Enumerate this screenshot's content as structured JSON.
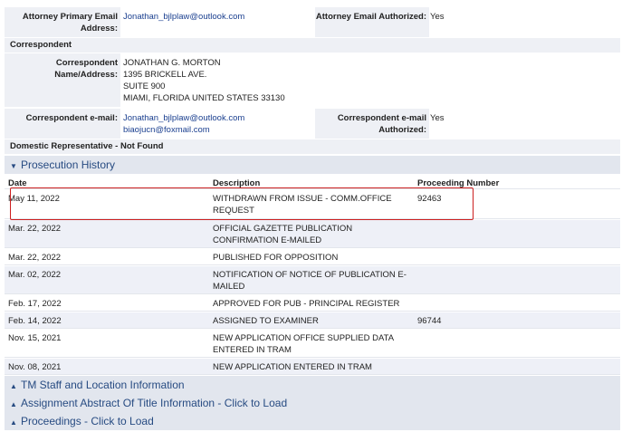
{
  "attorney": {
    "email_label": "Attorney Primary Email Address:",
    "email_value": "Jonathan_bjlplaw@outlook.com",
    "email_auth_label": "Attorney Email Authorized:",
    "email_auth_value": "Yes"
  },
  "correspondent": {
    "section_label": "Correspondent",
    "name_label": "Correspondent Name/Address:",
    "address_lines": [
      "JONATHAN G. MORTON",
      "1395 BRICKELL AVE.",
      "SUITE 900",
      "MIAMI, FLORIDA UNITED STATES 33130"
    ],
    "email_label": "Correspondent e-mail:",
    "emails": [
      "Jonathan_bjlplaw@outlook.com",
      "biaojucn@foxmail.com"
    ],
    "email_auth_label": "Correspondent e-mail Authorized:",
    "email_auth_value": "Yes"
  },
  "domestic_rep": "Domestic Representative - Not Found",
  "prosecution_history": {
    "title": "Prosecution History",
    "columns": [
      "Date",
      "Description",
      "Proceeding Number"
    ],
    "rows": [
      {
        "date": "May 11, 2022",
        "desc": "WITHDRAWN FROM ISSUE - COMM.OFFICE REQUEST",
        "num": "92463"
      },
      {
        "date": "Mar. 22, 2022",
        "desc": "OFFICIAL GAZETTE PUBLICATION CONFIRMATION E-MAILED",
        "num": ""
      },
      {
        "date": "Mar. 22, 2022",
        "desc": "PUBLISHED FOR OPPOSITION",
        "num": ""
      },
      {
        "date": "Mar. 02, 2022",
        "desc": "NOTIFICATION OF NOTICE OF PUBLICATION E-MAILED",
        "num": ""
      },
      {
        "date": "Feb. 17, 2022",
        "desc": "APPROVED FOR PUB - PRINCIPAL REGISTER",
        "num": ""
      },
      {
        "date": "Feb. 14, 2022",
        "desc": "ASSIGNED TO EXAMINER",
        "num": "96744"
      },
      {
        "date": "Nov. 15, 2021",
        "desc": "NEW APPLICATION OFFICE SUPPLIED DATA ENTERED IN TRAM",
        "num": ""
      },
      {
        "date": "Nov. 08, 2021",
        "desc": "NEW APPLICATION ENTERED IN TRAM",
        "num": ""
      }
    ]
  },
  "collapsed_sections": [
    "TM Staff and Location Information",
    "Assignment Abstract Of Title Information - Click to Load",
    "Proceedings - Click to Load"
  ],
  "icons": {
    "expanded": "triangle-down-icon",
    "collapsed": "triangle-right-icon"
  },
  "colors": {
    "panel_header_text": "#274b82",
    "link": "#1a3f8f",
    "highlight_box": "#cc1f1f"
  }
}
